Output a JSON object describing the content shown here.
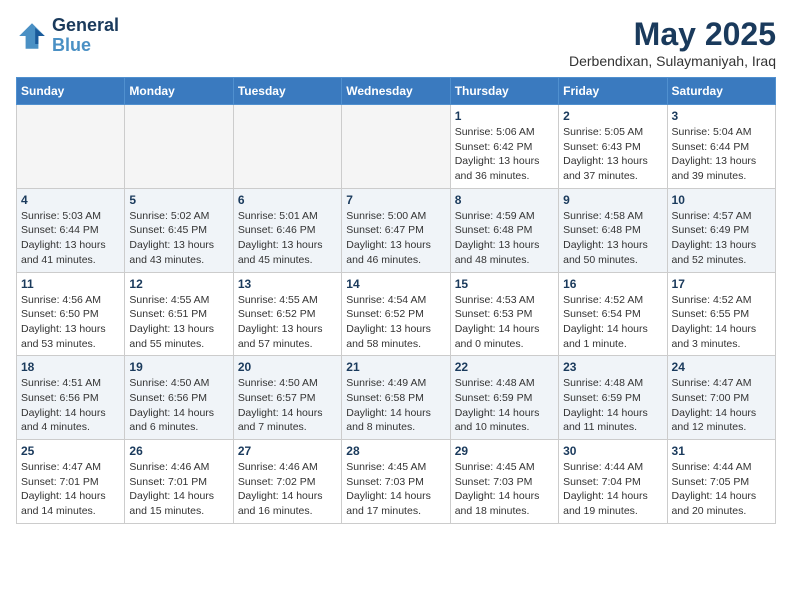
{
  "header": {
    "logo_line1": "General",
    "logo_line2": "Blue",
    "month_title": "May 2025",
    "location": "Derbendixan, Sulaymaniyah, Iraq"
  },
  "weekdays": [
    "Sunday",
    "Monday",
    "Tuesday",
    "Wednesday",
    "Thursday",
    "Friday",
    "Saturday"
  ],
  "rows": [
    [
      {
        "day": "",
        "info": ""
      },
      {
        "day": "",
        "info": ""
      },
      {
        "day": "",
        "info": ""
      },
      {
        "day": "",
        "info": ""
      },
      {
        "day": "1",
        "info": "Sunrise: 5:06 AM\nSunset: 6:42 PM\nDaylight: 13 hours\nand 36 minutes."
      },
      {
        "day": "2",
        "info": "Sunrise: 5:05 AM\nSunset: 6:43 PM\nDaylight: 13 hours\nand 37 minutes."
      },
      {
        "day": "3",
        "info": "Sunrise: 5:04 AM\nSunset: 6:44 PM\nDaylight: 13 hours\nand 39 minutes."
      }
    ],
    [
      {
        "day": "4",
        "info": "Sunrise: 5:03 AM\nSunset: 6:44 PM\nDaylight: 13 hours\nand 41 minutes."
      },
      {
        "day": "5",
        "info": "Sunrise: 5:02 AM\nSunset: 6:45 PM\nDaylight: 13 hours\nand 43 minutes."
      },
      {
        "day": "6",
        "info": "Sunrise: 5:01 AM\nSunset: 6:46 PM\nDaylight: 13 hours\nand 45 minutes."
      },
      {
        "day": "7",
        "info": "Sunrise: 5:00 AM\nSunset: 6:47 PM\nDaylight: 13 hours\nand 46 minutes."
      },
      {
        "day": "8",
        "info": "Sunrise: 4:59 AM\nSunset: 6:48 PM\nDaylight: 13 hours\nand 48 minutes."
      },
      {
        "day": "9",
        "info": "Sunrise: 4:58 AM\nSunset: 6:48 PM\nDaylight: 13 hours\nand 50 minutes."
      },
      {
        "day": "10",
        "info": "Sunrise: 4:57 AM\nSunset: 6:49 PM\nDaylight: 13 hours\nand 52 minutes."
      }
    ],
    [
      {
        "day": "11",
        "info": "Sunrise: 4:56 AM\nSunset: 6:50 PM\nDaylight: 13 hours\nand 53 minutes."
      },
      {
        "day": "12",
        "info": "Sunrise: 4:55 AM\nSunset: 6:51 PM\nDaylight: 13 hours\nand 55 minutes."
      },
      {
        "day": "13",
        "info": "Sunrise: 4:55 AM\nSunset: 6:52 PM\nDaylight: 13 hours\nand 57 minutes."
      },
      {
        "day": "14",
        "info": "Sunrise: 4:54 AM\nSunset: 6:52 PM\nDaylight: 13 hours\nand 58 minutes."
      },
      {
        "day": "15",
        "info": "Sunrise: 4:53 AM\nSunset: 6:53 PM\nDaylight: 14 hours\nand 0 minutes."
      },
      {
        "day": "16",
        "info": "Sunrise: 4:52 AM\nSunset: 6:54 PM\nDaylight: 14 hours\nand 1 minute."
      },
      {
        "day": "17",
        "info": "Sunrise: 4:52 AM\nSunset: 6:55 PM\nDaylight: 14 hours\nand 3 minutes."
      }
    ],
    [
      {
        "day": "18",
        "info": "Sunrise: 4:51 AM\nSunset: 6:56 PM\nDaylight: 14 hours\nand 4 minutes."
      },
      {
        "day": "19",
        "info": "Sunrise: 4:50 AM\nSunset: 6:56 PM\nDaylight: 14 hours\nand 6 minutes."
      },
      {
        "day": "20",
        "info": "Sunrise: 4:50 AM\nSunset: 6:57 PM\nDaylight: 14 hours\nand 7 minutes."
      },
      {
        "day": "21",
        "info": "Sunrise: 4:49 AM\nSunset: 6:58 PM\nDaylight: 14 hours\nand 8 minutes."
      },
      {
        "day": "22",
        "info": "Sunrise: 4:48 AM\nSunset: 6:59 PM\nDaylight: 14 hours\nand 10 minutes."
      },
      {
        "day": "23",
        "info": "Sunrise: 4:48 AM\nSunset: 6:59 PM\nDaylight: 14 hours\nand 11 minutes."
      },
      {
        "day": "24",
        "info": "Sunrise: 4:47 AM\nSunset: 7:00 PM\nDaylight: 14 hours\nand 12 minutes."
      }
    ],
    [
      {
        "day": "25",
        "info": "Sunrise: 4:47 AM\nSunset: 7:01 PM\nDaylight: 14 hours\nand 14 minutes."
      },
      {
        "day": "26",
        "info": "Sunrise: 4:46 AM\nSunset: 7:01 PM\nDaylight: 14 hours\nand 15 minutes."
      },
      {
        "day": "27",
        "info": "Sunrise: 4:46 AM\nSunset: 7:02 PM\nDaylight: 14 hours\nand 16 minutes."
      },
      {
        "day": "28",
        "info": "Sunrise: 4:45 AM\nSunset: 7:03 PM\nDaylight: 14 hours\nand 17 minutes."
      },
      {
        "day": "29",
        "info": "Sunrise: 4:45 AM\nSunset: 7:03 PM\nDaylight: 14 hours\nand 18 minutes."
      },
      {
        "day": "30",
        "info": "Sunrise: 4:44 AM\nSunset: 7:04 PM\nDaylight: 14 hours\nand 19 minutes."
      },
      {
        "day": "31",
        "info": "Sunrise: 4:44 AM\nSunset: 7:05 PM\nDaylight: 14 hours\nand 20 minutes."
      }
    ]
  ]
}
